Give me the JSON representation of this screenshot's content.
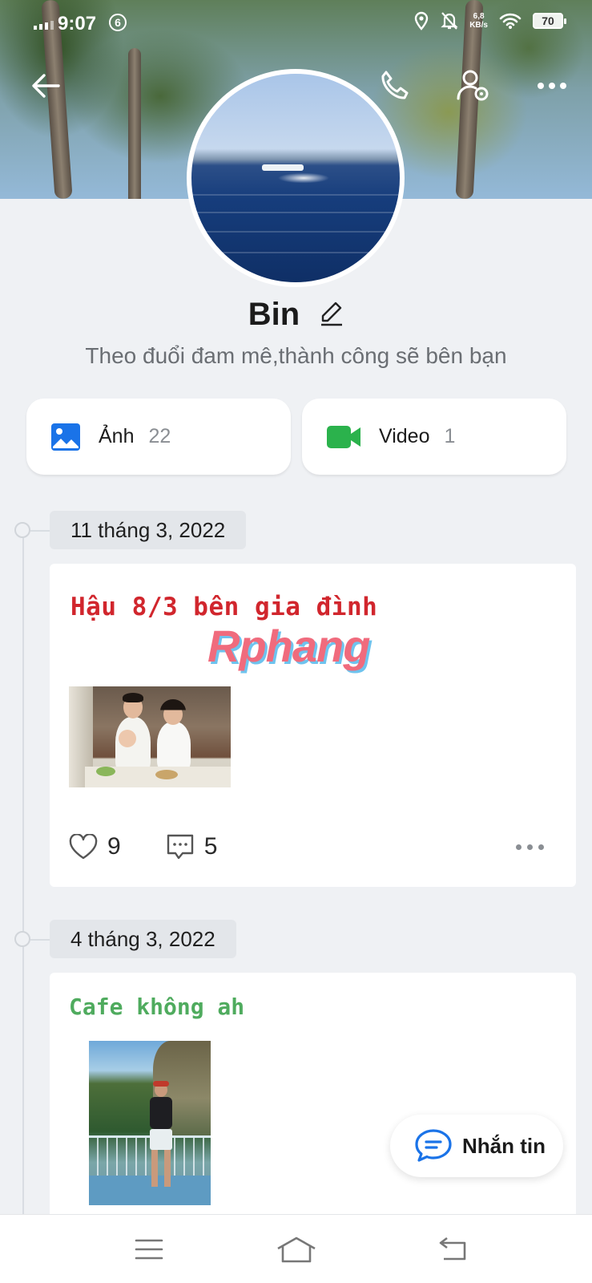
{
  "status_bar": {
    "time": "9:07",
    "notification_count": "6",
    "net_speed_value": "6,8",
    "net_speed_unit": "KB/s",
    "battery": "70",
    "icons": [
      "signal-icon",
      "location-icon",
      "bell-off-icon",
      "wifi-icon",
      "battery-icon"
    ]
  },
  "header": {
    "icons": [
      "back-arrow-icon",
      "phone-icon",
      "user-settings-icon",
      "more-icon"
    ]
  },
  "profile": {
    "name": "Bin",
    "bio": "Theo đuổi đam mê,thành công sẽ bên bạn"
  },
  "media": {
    "photos_label": "Ảnh",
    "photos_count": "22",
    "videos_label": "Video",
    "videos_count": "1",
    "accent_photo": "#1a73e8",
    "accent_video": "#2bb24c"
  },
  "posts": [
    {
      "date": "11 tháng 3, 2022",
      "title": "Hậu 8/3 bên gia đình",
      "title_color": "#d1262d",
      "watermark": "Rphang",
      "likes": "9",
      "comments": "5"
    },
    {
      "date": "4 tháng 3, 2022",
      "title": "Cafe không ah",
      "title_color": "#4fab5e"
    }
  ],
  "message_button": {
    "label": "Nhắn tin",
    "accent": "#1a73e8"
  },
  "navbar": {
    "icons": [
      "menu-icon",
      "home-icon",
      "back-icon"
    ]
  }
}
